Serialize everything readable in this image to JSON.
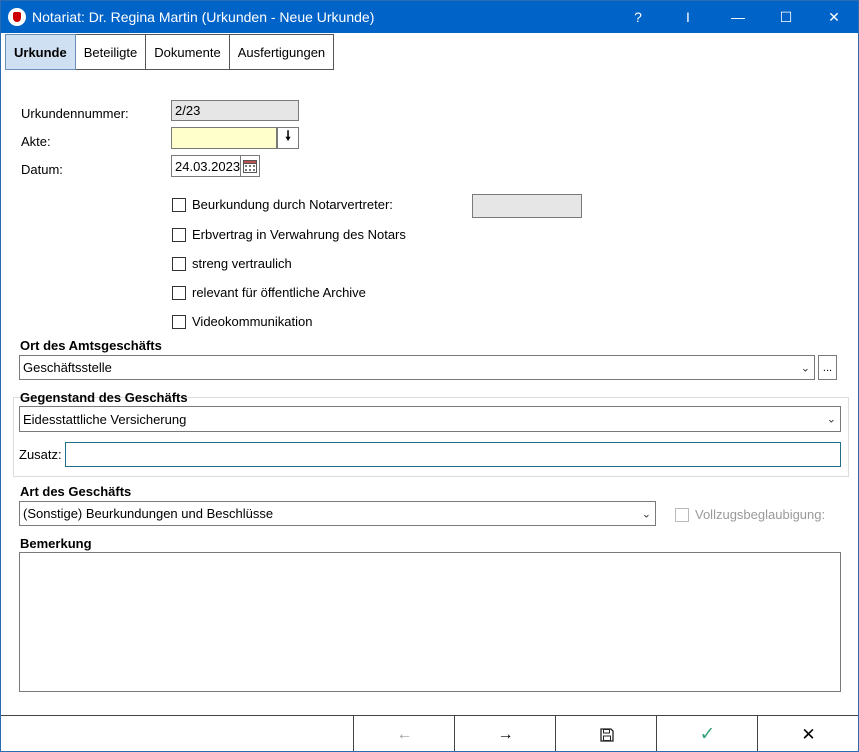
{
  "window": {
    "title": "Notariat: Dr. Regina Martin (Urkunden - Neue Urkunde)",
    "help_label": "?",
    "cursor_label": "I",
    "minimize_label": "—",
    "maximize_label": "☐",
    "close_label": "✕"
  },
  "tabs": [
    {
      "label": "Urkunde",
      "active": true
    },
    {
      "label": "Beteiligte",
      "active": false
    },
    {
      "label": "Dokumente",
      "active": false
    },
    {
      "label": "Ausfertigungen",
      "active": false
    }
  ],
  "form": {
    "urkundennummer_label": "Urkundennummer:",
    "urkundennummer_value": "2/23",
    "akte_label": "Akte:",
    "akte_value": "",
    "akte_button": "🠗",
    "datum_label": "Datum:",
    "datum_value": "24.03.2023",
    "checkboxes": {
      "notarvertreter": "Beurkundung durch Notarvertreter:",
      "erbvertrag": "Erbvertrag in Verwahrung des Notars",
      "vertraulich": "streng vertraulich",
      "archive": "relevant für öffentliche Archive",
      "video": "Videokommunikation"
    },
    "notarvertreter_value": ""
  },
  "ort": {
    "heading": "Ort des Amtsgeschäfts",
    "value": "Geschäftsstelle",
    "more_button": "..."
  },
  "gegenstand": {
    "heading": "Gegenstand des Geschäfts",
    "value": "Eidesstattliche Versicherung",
    "zusatz_label": "Zusatz:",
    "zusatz_value": ""
  },
  "art": {
    "heading": "Art des Geschäfts",
    "value": "(Sonstige) Beurkundungen und Beschlüsse",
    "vollzug_label": "Vollzugsbeglaubigung:"
  },
  "bemerkung": {
    "heading": "Bemerkung",
    "value": ""
  },
  "bottom": {
    "back": "←",
    "forward": "→",
    "save": "💾",
    "ok": "✓",
    "cancel": "✕"
  },
  "colors": {
    "titlebar": "#0063c8",
    "active_tab": "#cfe0f3",
    "ok_check": "#3aa37a"
  }
}
